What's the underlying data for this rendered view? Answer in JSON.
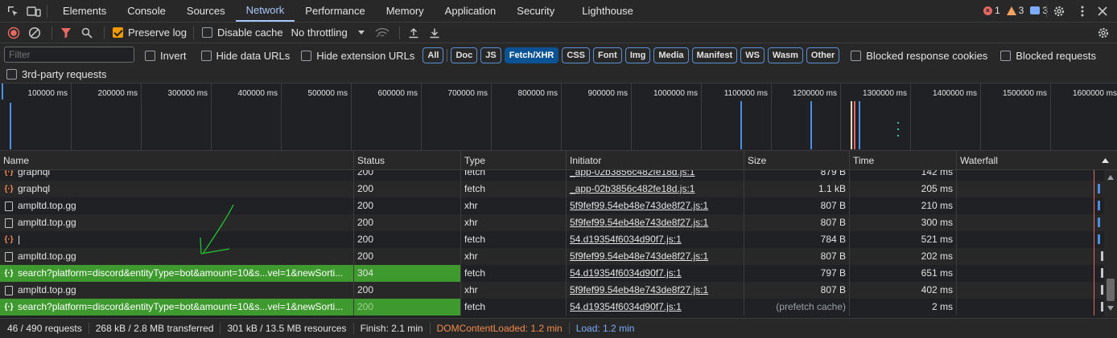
{
  "tabbar": {
    "tabs": [
      "Elements",
      "Console",
      "Sources",
      "Network",
      "Performance",
      "Memory",
      "Application",
      "Security",
      "Lighthouse"
    ],
    "active": "Network",
    "issues": {
      "errors": "1",
      "warnings": "3",
      "messages": "3"
    }
  },
  "toolbar": {
    "preserve_log": "Preserve log",
    "disable_cache": "Disable cache",
    "throttling": "No throttling"
  },
  "filter": {
    "placeholder": "Filter",
    "invert": "Invert",
    "hide_data_urls": "Hide data URLs",
    "hide_ext_urls": "Hide extension URLs",
    "types": [
      "All",
      "Doc",
      "JS",
      "Fetch/XHR",
      "CSS",
      "Font",
      "Img",
      "Media",
      "Manifest",
      "WS",
      "Wasm",
      "Other"
    ],
    "selected_type": "Fetch/XHR",
    "blocked_cookies": "Blocked response cookies",
    "blocked_requests": "Blocked requests",
    "third_party": "3rd-party requests"
  },
  "overview": {
    "ticks": [
      "100000 ms",
      "200000 ms",
      "300000 ms",
      "400000 ms",
      "500000 ms",
      "600000 ms",
      "700000 ms",
      "800000 ms",
      "900000 ms",
      "1000000 ms",
      "1100000 ms",
      "1200000 ms",
      "1300000 ms",
      "1400000 ms",
      "1500000 ms",
      "1600000 ms"
    ]
  },
  "table": {
    "headers": {
      "name": "Name",
      "status": "Status",
      "type": "Type",
      "initiator": "Initiator",
      "size": "Size",
      "time": "Time",
      "waterfall": "Waterfall"
    },
    "rows": [
      {
        "name": "graphql",
        "status": "200",
        "type": "fetch",
        "initiator": "_app-02b3856c482fe18d.js:1",
        "size": "879 B",
        "time": "142 ms"
      },
      {
        "name": "graphql",
        "status": "200",
        "type": "fetch",
        "initiator": "_app-02b3856c482fe18d.js:1",
        "size": "1.1 kB",
        "time": "205 ms"
      },
      {
        "name": "ampltd.top.gg",
        "status": "200",
        "type": "xhr",
        "initiator": "5f9fef99.54eb48e743de8f27.js:1",
        "size": "807 B",
        "time": "210 ms"
      },
      {
        "name": "ampltd.top.gg",
        "status": "200",
        "type": "xhr",
        "initiator": "5f9fef99.54eb48e743de8f27.js:1",
        "size": "807 B",
        "time": "300 ms"
      },
      {
        "name": "|",
        "status": "200",
        "type": "fetch",
        "initiator": "54.d19354f6034d90f7.js:1",
        "size": "784 B",
        "time": "521 ms"
      },
      {
        "name": "ampltd.top.gg",
        "status": "200",
        "type": "xhr",
        "initiator": "5f9fef99.54eb48e743de8f27.js:1",
        "size": "807 B",
        "time": "202 ms"
      },
      {
        "name": "search?platform=discord&entityType=bot&amount=10&s...vel=1&newSorti...",
        "status": "304",
        "type": "fetch",
        "initiator": "54.d19354f6034d90f7.js:1",
        "size": "797 B",
        "time": "651 ms"
      },
      {
        "name": "ampltd.top.gg",
        "status": "200",
        "type": "xhr",
        "initiator": "5f9fef99.54eb48e743de8f27.js:1",
        "size": "807 B",
        "time": "402 ms"
      },
      {
        "name": "search?platform=discord&entityType=bot&amount=10&s...vel=1&newSorti...",
        "status": "200",
        "type": "fetch",
        "initiator": "54.d19354f6034d90f7.js:1",
        "size": "(prefetch cache)",
        "time": "2 ms"
      }
    ]
  },
  "statusbar": {
    "requests": "46 / 490 requests",
    "transferred": "268 kB / 2.8 MB transferred",
    "resources": "301 kB / 13.5 MB resources",
    "finish": "Finish: 2.1 min",
    "dcl": "DOMContentLoaded: 1.2 min",
    "load": "Load: 1.2 min"
  },
  "colors": {
    "accent": "#a8c7fa",
    "highlight": "#3e9a2e",
    "record": "#e46962",
    "preserve": "#f29900"
  },
  "icons": [
    "inspect-icon",
    "device-icon",
    "record-icon",
    "clear-icon",
    "filter-icon",
    "search-icon",
    "wifi-icon",
    "upload-icon",
    "download-icon",
    "gear-icon",
    "close-icon"
  ]
}
